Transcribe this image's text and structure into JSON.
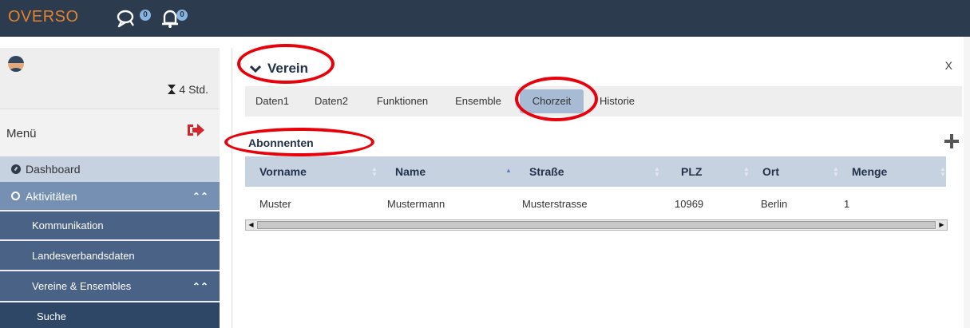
{
  "app": {
    "brand": "OVERSO"
  },
  "topbar": {
    "messages_count": "0",
    "notifications_count": "0"
  },
  "sidebar": {
    "hours": "4 Std.",
    "menu_label": "Menü",
    "items": [
      {
        "label": "Dashboard"
      },
      {
        "label": "Aktivitäten"
      },
      {
        "label": "Kommunikation"
      },
      {
        "label": "Landesverbandsdaten"
      },
      {
        "label": "Vereine & Ensembles"
      },
      {
        "label": "Suche"
      }
    ]
  },
  "panel": {
    "title": "Verein",
    "close_label": "X",
    "tabs": [
      {
        "label": "Daten1"
      },
      {
        "label": "Daten2"
      },
      {
        "label": "Funktionen"
      },
      {
        "label": "Ensemble"
      },
      {
        "label": "Chorzeit",
        "active": true
      },
      {
        "label": "Historie"
      }
    ],
    "section_title": "Abonnenten",
    "table": {
      "columns": [
        "Vorname",
        "Name",
        "Straße",
        "PLZ",
        "Ort",
        "Menge"
      ],
      "sorted_column": "Name",
      "rows": [
        [
          "Muster",
          "Mustermann",
          "Musterstrasse",
          "10969",
          "Berlin",
          "1"
        ]
      ]
    }
  },
  "colors": {
    "topbar": "#2d3b4e",
    "brand": "#e2832f",
    "logout": "#d1262b",
    "annotation": "#e8000a",
    "active_tab": "#a8bbd5",
    "table_header": "#c7d2e0"
  },
  "icons": [
    "chat-icon",
    "bell-icon",
    "avatar-icon",
    "hourglass-icon",
    "logout-icon",
    "dashboard-icon",
    "circle-icon",
    "chevron-up-icon",
    "chevron-down-icon",
    "plus-icon"
  ]
}
